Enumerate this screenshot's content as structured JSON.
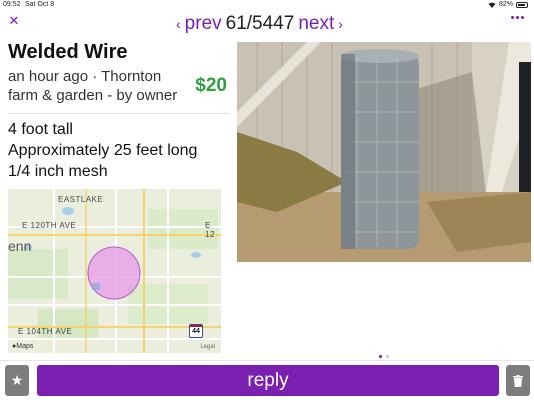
{
  "status_bar": {
    "time": "09:52",
    "date": "Sat Oct 8",
    "battery": "82%"
  },
  "nav": {
    "prev_label": "prev",
    "count": "61/5447",
    "next_label": "next",
    "close_icon": "close-icon",
    "more_icon": "more-icon"
  },
  "listing": {
    "title": "Welded Wire",
    "posted": "an hour ago · Thornton",
    "category": "farm & garden - by owner",
    "price": "$20",
    "description": [
      "4 foot tall",
      "Approximately 25 feet long",
      "1/4 inch mesh"
    ]
  },
  "map": {
    "labels": {
      "eastlake": "EASTLAKE",
      "e120": "E 120TH AVE",
      "e12": "E 12",
      "enn": "enn",
      "e104": "E 104TH AVE"
    },
    "attribution": "Maps",
    "legal": "Legal",
    "highway_shield": "44"
  },
  "photo": {
    "page_count": 2,
    "current_page": 1
  },
  "actions": {
    "reply_label": "reply",
    "favorite_icon": "star-icon",
    "delete_icon": "trash-icon"
  },
  "colors": {
    "accent": "#7a1fb0",
    "price": "#2e9e3e",
    "secondary_button": "#7d7d7d"
  }
}
